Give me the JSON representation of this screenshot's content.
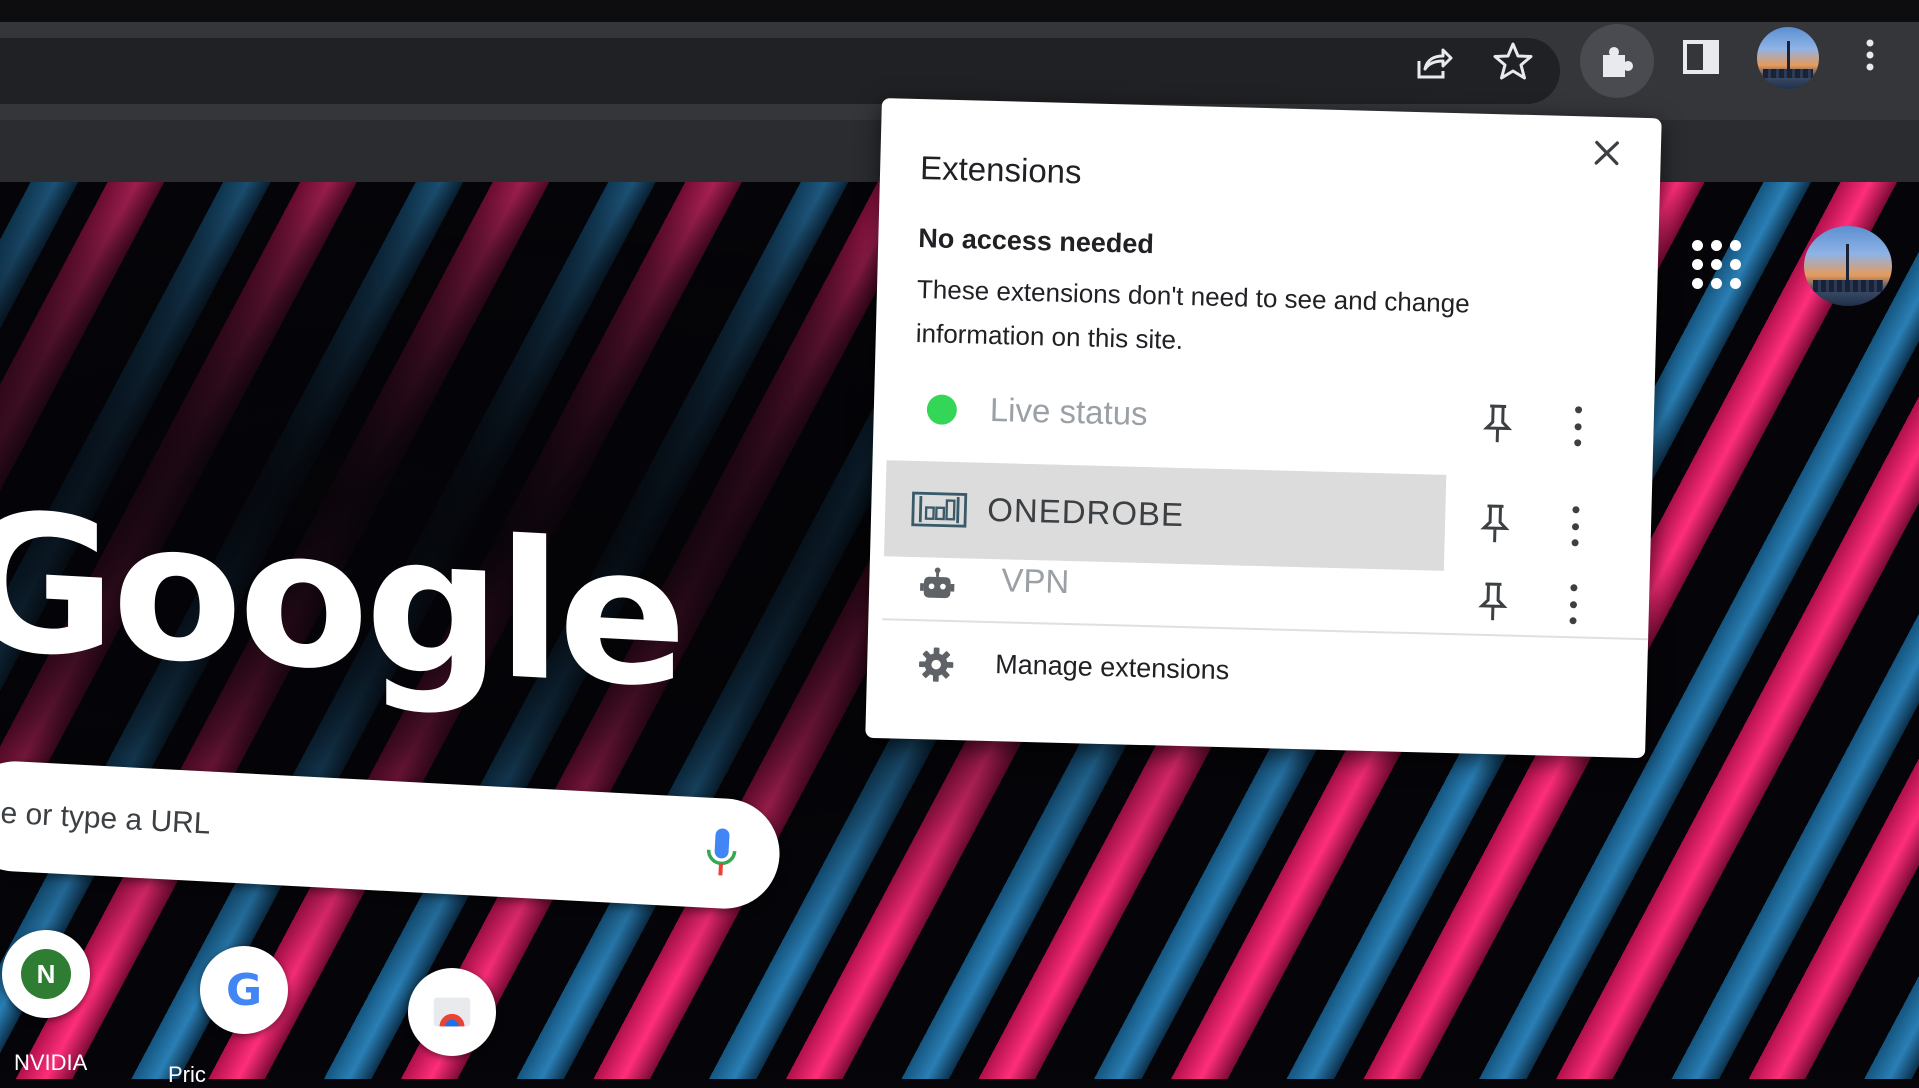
{
  "toolbar": {
    "share_icon": "share-icon",
    "bookmark_icon": "star-icon",
    "extensions_icon": "puzzle-piece-icon",
    "side_panel_icon": "side-panel-icon",
    "menu_icon": "three-dot-vertical-icon"
  },
  "popup": {
    "title": "Extensions",
    "close_icon": "close-icon",
    "section_heading": "No access needed",
    "section_description": "These extensions don't need to see and change information on this site.",
    "extensions": [
      {
        "name": "Live status",
        "icon": "green-dot-icon",
        "icon_color": "#34d658"
      },
      {
        "name": "ONEDROBE",
        "icon": "wardrobe-icon",
        "icon_color": "#3a5a6a"
      },
      {
        "name": "VPN",
        "icon": "robot-icon",
        "icon_color": "#5f6368"
      }
    ],
    "pin_icon": "pin-icon",
    "more_icon": "more-vert-icon",
    "manage_label": "Manage extensions",
    "manage_icon": "gear-icon"
  },
  "ntp": {
    "logo_text": "Google",
    "search_placeholder": "e or type a URL",
    "mic_icon": "microphone-icon",
    "apps_icon": "apps-grid-icon",
    "shortcuts": [
      {
        "label": "NVIDIA",
        "letter": "N",
        "color": "#2e7d32"
      },
      {
        "label": "Pric",
        "letter": "G",
        "color": "#4285f4"
      },
      {
        "label": "",
        "letter": "",
        "color": "#ea4335"
      }
    ]
  },
  "colors": {
    "toolbar": "#35363a",
    "omnibox": "#202124",
    "accent_pink": "#ff2e7a",
    "accent_blue": "#2a7fb5",
    "highlight_row": "#dcdcdc"
  }
}
